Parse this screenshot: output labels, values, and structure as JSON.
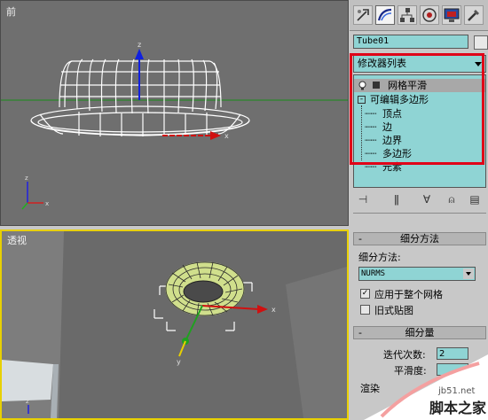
{
  "front_viewport": {
    "label": "前"
  },
  "persp_viewport": {
    "label": "透视"
  },
  "tabs": [
    {
      "icon": "create-icon"
    },
    {
      "icon": "modify-icon"
    },
    {
      "icon": "hierarchy-icon"
    },
    {
      "icon": "motion-icon"
    },
    {
      "icon": "display-icon"
    },
    {
      "icon": "utilities-icon"
    }
  ],
  "object_name": "Tube01",
  "object_color": "#e8e8e8",
  "modifier_list": {
    "label": "修改器列表"
  },
  "stack": {
    "items": [
      {
        "label": "网格平滑",
        "selected": true
      },
      {
        "label": "可编辑多边形"
      },
      {
        "label": "顶点"
      },
      {
        "label": "边"
      },
      {
        "label": "边界"
      },
      {
        "label": "多边形"
      },
      {
        "label": "元素"
      }
    ]
  },
  "subdivision_method": {
    "title": "细分方法",
    "method_label": "细分方法:",
    "method_value": "NURMS",
    "apply_whole_mesh": {
      "label": "应用于整个网格",
      "checked": true
    },
    "old_style_mapping": {
      "label": "旧式贴图",
      "checked": false
    }
  },
  "subdivision_amount": {
    "title": "细分量",
    "iterations_label": "迭代次数:",
    "iterations_value": "2",
    "smoothness_label": "平滑度:",
    "render_label": "渲染"
  },
  "rollout_minus": "-",
  "axis": {
    "x": "x",
    "y": "y",
    "z": "z"
  },
  "watermark": {
    "site": "jb51.net",
    "name": "脚本之家"
  },
  "colors": {
    "viewport_bg": "#6f6f6f",
    "active_border": "#e8d000",
    "highlight_box": "#e00018",
    "field_bg": "#8fd4d4"
  }
}
